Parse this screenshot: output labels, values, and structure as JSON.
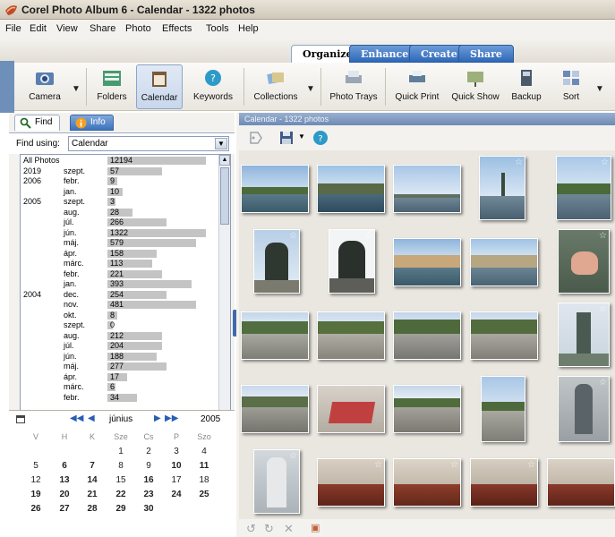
{
  "window": {
    "title": "Corel Photo Album 6 - Calendar - 1322 photos"
  },
  "menu": [
    "File",
    "Edit",
    "View",
    "Share",
    "Photo",
    "Effects",
    "Tools",
    "Help"
  ],
  "tabs": [
    "Organize",
    "Enhance",
    "Create",
    "Share"
  ],
  "toolbar": [
    "Camera",
    "Folders",
    "Calendar",
    "Keywords",
    "Collections",
    "Photo Trays",
    "Quick Print",
    "Quick Show",
    "Backup",
    "Sort"
  ],
  "left_panel": {
    "tabs": [
      "Find",
      "Info"
    ],
    "find_label": "Find using:",
    "find_value": "Calendar"
  },
  "date_list": [
    {
      "year": "All Photos",
      "month": "",
      "count": "12194",
      "bar": 1.0
    },
    {
      "year": "2019",
      "month": "szept.",
      "count": "57",
      "bar": 0.55
    },
    {
      "year": "2006",
      "month": "febr.",
      "count": "9",
      "bar": 0.1
    },
    {
      "year": "",
      "month": "jan.",
      "count": "10",
      "bar": 0.15
    },
    {
      "year": "2005",
      "month": "szept.",
      "count": "3",
      "bar": 0.08
    },
    {
      "year": "",
      "month": "aug.",
      "count": "28",
      "bar": 0.25
    },
    {
      "year": "",
      "month": "júl.",
      "count": "266",
      "bar": 0.6
    },
    {
      "year": "",
      "month": "jún.",
      "count": "1322",
      "bar": 1.0
    },
    {
      "year": "",
      "month": "máj.",
      "count": "579",
      "bar": 0.9
    },
    {
      "year": "",
      "month": "ápr.",
      "count": "158",
      "bar": 0.5
    },
    {
      "year": "",
      "month": "márc.",
      "count": "113",
      "bar": 0.45
    },
    {
      "year": "",
      "month": "febr.",
      "count": "221",
      "bar": 0.55
    },
    {
      "year": "",
      "month": "jan.",
      "count": "393",
      "bar": 0.85
    },
    {
      "year": "2004",
      "month": "dec.",
      "count": "254",
      "bar": 0.6
    },
    {
      "year": "",
      "month": "nov.",
      "count": "481",
      "bar": 0.9
    },
    {
      "year": "",
      "month": "okt.",
      "count": "8",
      "bar": 0.1
    },
    {
      "year": "",
      "month": "szept.",
      "count": "0",
      "bar": 0.05
    },
    {
      "year": "",
      "month": "aug.",
      "count": "212",
      "bar": 0.55
    },
    {
      "year": "",
      "month": "júl.",
      "count": "204",
      "bar": 0.55
    },
    {
      "year": "",
      "month": "jún.",
      "count": "188",
      "bar": 0.5
    },
    {
      "year": "",
      "month": "máj.",
      "count": "277",
      "bar": 0.6
    },
    {
      "year": "",
      "month": "ápr.",
      "count": "17",
      "bar": 0.2
    },
    {
      "year": "",
      "month": "márc.",
      "count": "6",
      "bar": 0.08
    },
    {
      "year": "",
      "month": "febr.",
      "count": "34",
      "bar": 0.3
    }
  ],
  "calendar": {
    "month": "június",
    "year": "2005",
    "weekdays": [
      "V",
      "H",
      "K",
      "Sze",
      "Cs",
      "P",
      "Szo"
    ],
    "days": [
      [
        "",
        "",
        "",
        "1",
        "2",
        "3",
        "4"
      ],
      [
        "5",
        "6",
        "7",
        "8",
        "9",
        "10",
        "11"
      ],
      [
        "12",
        "13",
        "14",
        "15",
        "16",
        "17",
        "18"
      ],
      [
        "19",
        "20",
        "21",
        "22",
        "23",
        "24",
        "25"
      ],
      [
        "26",
        "27",
        "28",
        "29",
        "30",
        "",
        ""
      ]
    ],
    "bold_days": [
      "6",
      "7",
      "10",
      "11",
      "13",
      "14",
      "16",
      "19",
      "20",
      "21",
      "22",
      "23",
      "24",
      "25",
      "26",
      "27",
      "28",
      "29",
      "30"
    ]
  },
  "right_panel": {
    "header": "Calendar - 1322 photos"
  }
}
